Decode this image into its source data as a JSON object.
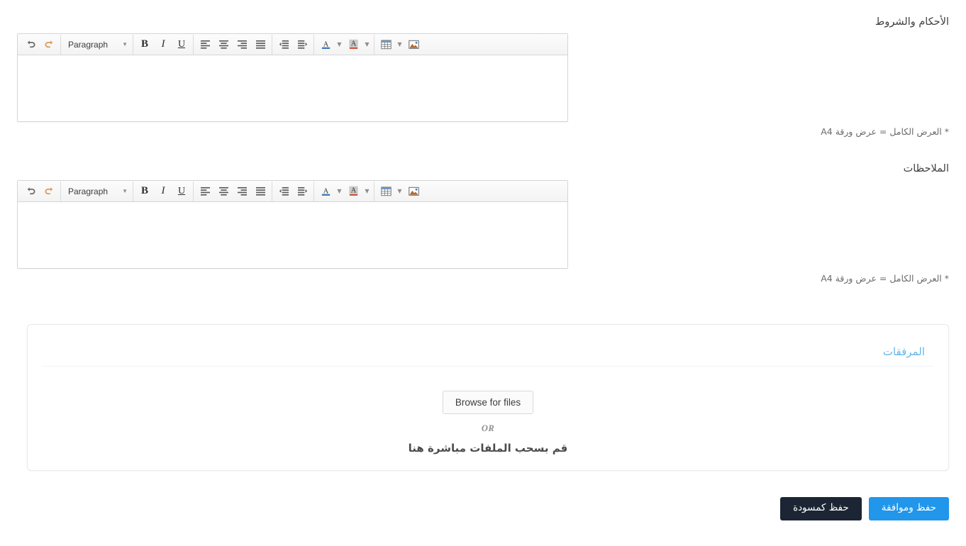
{
  "fields": [
    {
      "label": "الأحكام والشروط",
      "hint": "* العرض الكامل = عرض ورقة A4",
      "content": "",
      "toolbar": {
        "undo": "undo-icon",
        "redo": "redo-icon",
        "format_select": "Paragraph",
        "bold": "B",
        "italic": "I",
        "underline": "U",
        "align_left": "align-left-icon",
        "align_center": "align-center-icon",
        "align_right": "align-right-icon",
        "align_justify": "align-justify-icon",
        "outdent": "outdent-icon",
        "indent": "indent-icon",
        "text_color": "A",
        "background_color": "A",
        "table": "table-icon",
        "image": "image-icon"
      }
    },
    {
      "label": "الملاحظات",
      "hint": "* العرض الكامل = عرض ورقة A4",
      "content": "",
      "toolbar": {
        "undo": "undo-icon",
        "redo": "redo-icon",
        "format_select": "Paragraph",
        "bold": "B",
        "italic": "I",
        "underline": "U",
        "align_left": "align-left-icon",
        "align_center": "align-center-icon",
        "align_right": "align-right-icon",
        "align_justify": "align-justify-icon",
        "outdent": "outdent-icon",
        "indent": "indent-icon",
        "text_color": "A",
        "background_color": "A",
        "table": "table-icon",
        "image": "image-icon"
      }
    }
  ],
  "attachments": {
    "title": "المرفقات",
    "browse_label": "Browse for files",
    "or_label": "OR",
    "drag_label": "قم بسحب الملفات مباشرة هنا"
  },
  "footer": {
    "primary_label": "حفظ وموافقة",
    "secondary_label": "حفظ كمسودة"
  },
  "colors": {
    "primary": "#2196ea",
    "dark": "#1b2533",
    "accent_title": "#63b7e8",
    "label": "#3f3f3f",
    "hint": "#6b6b6b"
  }
}
